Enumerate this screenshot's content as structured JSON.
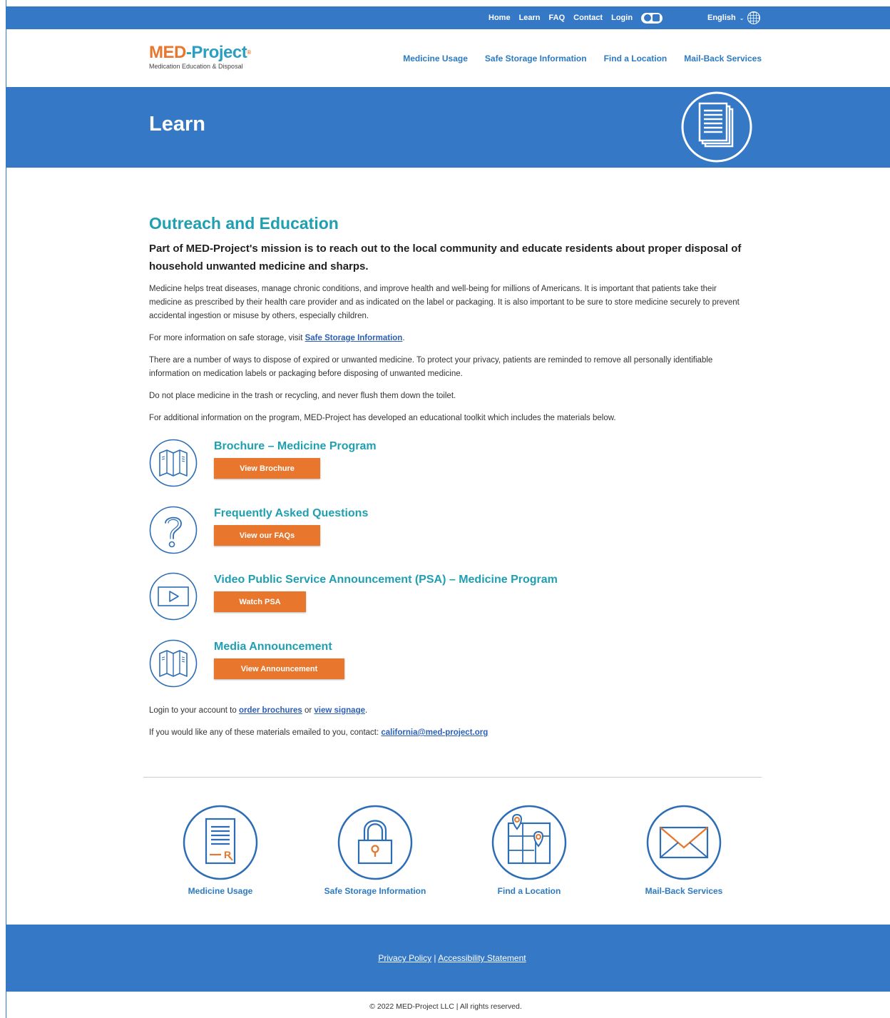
{
  "topnav": {
    "home": "Home",
    "learn": "Learn",
    "faq": "FAQ",
    "contact": "Contact",
    "login": "Login",
    "language": "English"
  },
  "logo": {
    "med": "MED",
    "dash": "-",
    "project": "Project",
    "mark": "®",
    "tagline": "Medication Education & Disposal"
  },
  "mainnav": {
    "usage": "Medicine Usage",
    "storage": "Safe Storage Information",
    "location": "Find a Location",
    "mailback": "Mail-Back Services"
  },
  "hero": {
    "title": "Learn"
  },
  "content": {
    "heading": "Outreach and Education",
    "lead": "Part of MED-Project's mission is to reach out to the local community and educate residents about proper disposal of household unwanted medicine and sharps.",
    "p1": "Medicine helps treat diseases, manage chronic conditions, and improve health and well-being for millions of Americans. It is important that patients take their medicine as prescribed by their health care provider and as indicated on the label or packaging. It is also important to be sure to store medicine securely to prevent accidental ingestion or misuse by others, especially children.",
    "p2_before": "For more information on safe storage, visit ",
    "p2_link": "Safe Storage Information",
    "p2_after": ".",
    "p3": "There are a number of ways to dispose of expired or unwanted medicine. To protect your privacy, patients are reminded to remove all personally identifiable information on medication labels or packaging before disposing of unwanted medicine.",
    "p4": "Do not place medicine in the trash or recycling, and never flush them down the toilet.",
    "p5": "For additional information on the program, MED-Project has developed an educational toolkit which includes the materials below."
  },
  "materials": [
    {
      "title": "Brochure – Medicine Program",
      "button": "View Brochure",
      "icon": "brochure-icon"
    },
    {
      "title": "Frequently Asked Questions",
      "button": "View our FAQs",
      "icon": "question-icon"
    },
    {
      "title": "Video Public Service Announcement (PSA) – Medicine Program",
      "button": "Watch PSA",
      "icon": "video-play-icon"
    },
    {
      "title": "Media Announcement",
      "button": "View Announcement",
      "icon": "brochure-icon"
    }
  ],
  "notes": {
    "login_before": "Login to your account to ",
    "login_link1": "order brochures",
    "login_mid": " or ",
    "login_link2": "view signage",
    "login_after": ".",
    "email_before": "If you would like any of these materials emailed to you, contact: ",
    "email_link": "california@med-project.org"
  },
  "bottom_links": [
    {
      "label": "Medicine Usage",
      "icon": "prescription-document-icon"
    },
    {
      "label": "Safe Storage Information",
      "icon": "padlock-icon"
    },
    {
      "label": "Find a Location",
      "icon": "map-pin-icon"
    },
    {
      "label": "Mail-Back Services",
      "icon": "envelope-icon"
    }
  ],
  "footer": {
    "privacy": "Privacy Policy",
    "separator": " | ",
    "accessibility": "Accessibility Statement",
    "copyright": "© 2022 MED-Project LLC | All rights reserved."
  },
  "colors": {
    "brand_blue": "#3478c6",
    "teal_heading": "#1f9fb0",
    "orange_button": "#e8762d",
    "icon_blue": "#2c6db5"
  }
}
